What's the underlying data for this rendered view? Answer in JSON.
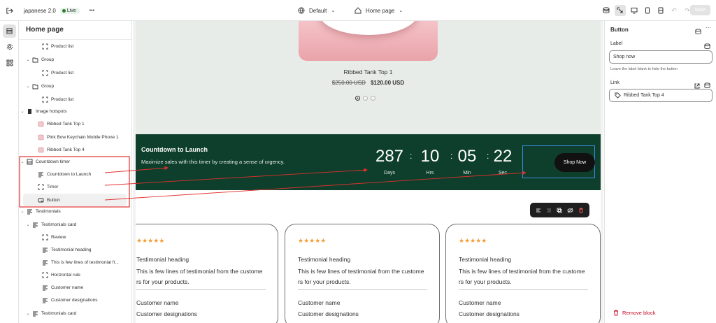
{
  "topbar": {
    "store_name": "japanese 2.0",
    "status_badge": "Live",
    "more_label": "•••",
    "theme_select": "Default",
    "page_select": "Home page",
    "save_label": "Save"
  },
  "sidebar": {
    "title": "Home page",
    "items": [
      {
        "label": "Product list",
        "icon": "section-icon"
      },
      {
        "label": "Group",
        "icon": "folder-icon"
      },
      {
        "label": "Product list",
        "icon": "section-icon"
      },
      {
        "label": "Group",
        "icon": "folder-icon"
      },
      {
        "label": "Product list",
        "icon": "section-icon"
      },
      {
        "label": "Image hotspots",
        "icon": "image-icon"
      },
      {
        "label": "Ribbed Tank Top 1",
        "icon": "product-thumb-icon"
      },
      {
        "label": "Pink Bow Keychain Mobile Phone 1",
        "icon": "product-thumb-icon"
      },
      {
        "label": "Ribbed Tank Top 4",
        "icon": "product-thumb-icon"
      },
      {
        "label": "Countdown timer",
        "icon": "timer-icon"
      },
      {
        "label": "Countdown to Launch",
        "icon": "text-icon"
      },
      {
        "label": "Timer",
        "icon": "section-icon"
      },
      {
        "label": "Button",
        "icon": "button-icon"
      },
      {
        "label": "Testimonials",
        "icon": "text-icon"
      },
      {
        "label": "Testimonials card",
        "icon": "text-icon"
      },
      {
        "label": "Review",
        "icon": "section-icon"
      },
      {
        "label": "Testimonial heading",
        "icon": "text-icon"
      },
      {
        "label": "This is few lines of testimonial fr...",
        "icon": "text-icon"
      },
      {
        "label": "Horizontal rule",
        "icon": "section-icon"
      },
      {
        "label": "Customer name",
        "icon": "text-icon"
      },
      {
        "label": "Customer designations",
        "icon": "text-icon"
      },
      {
        "label": "Testimonials card",
        "icon": "text-icon"
      }
    ]
  },
  "preview": {
    "product": {
      "title": "Ribbed Tank Top 1",
      "price_old": "$250.00 USD",
      "price_new": "$120.00 USD"
    },
    "countdown": {
      "heading": "Countdown to Launch",
      "subtext": "Maximize sales with this timer by creating a sense of urgency.",
      "days": "287",
      "hours": "10",
      "minutes": "05",
      "seconds": "22",
      "days_label": "Days",
      "hours_label": "Hrs",
      "minutes_label": "Min",
      "seconds_label": "Sec",
      "separator": ":",
      "button_label": "Shop Now"
    },
    "testimonials": [
      {
        "stars": "★★★★★",
        "heading": "Testimonial heading",
        "body": "This is few lines of testimonial from the custome rs for your products.",
        "name": "Customer name",
        "designation": "Customer designations"
      },
      {
        "stars": "★★★★★",
        "heading": "Testimonial heading",
        "body": "This is few lines of testimonial from the custome rs for your products.",
        "name": "Customer name",
        "designation": "Customer designations"
      },
      {
        "stars": "★★★★★",
        "heading": "Testimonial heading",
        "body": "This is few lines of testimonial from the custome rs for your products.",
        "name": "Customer name",
        "designation": "Customer designations"
      }
    ]
  },
  "inspector": {
    "title": "Button",
    "label_field_label": "Label",
    "label_value": "Shop now",
    "help_text": "Leave the label blank to hide the button",
    "link_field_label": "Link",
    "link_value": "Ribbed Tank Top 4",
    "remove_label": "Remove block"
  },
  "colors": {
    "countdown_bg": "#0e3f2c",
    "annotation_red": "#e0312d",
    "selection_blue": "#3c8de0",
    "star": "#f29e38",
    "danger": "#c70a24"
  }
}
